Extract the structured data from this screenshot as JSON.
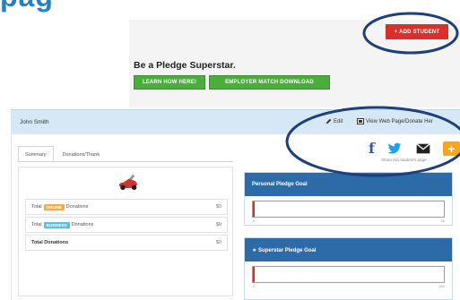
{
  "page": {
    "top_heading": "pag"
  },
  "promo": {
    "add_student_label": "+ ADD STUDENT",
    "superstar_title": "Be a Pledge Superstar.",
    "learn_button": "LEARN HOW HERE!",
    "employer_button": "EMPLOYER MATCH DOWNLOAD"
  },
  "profile": {
    "student_name": "John Smith",
    "edit_label": "Edit",
    "view_page_label": "View Web Page/Donate Her",
    "share_caption": "Share this student's page"
  },
  "tabs": [
    {
      "label": "Summary"
    },
    {
      "label": "Donations/Thank"
    }
  ],
  "donations": [
    {
      "prefix": "Total",
      "badge": "ONLINE",
      "suffix": "Donations",
      "value": "$0"
    },
    {
      "prefix": "Total",
      "badge": "BUSINESS",
      "suffix": "Donations",
      "value": "$0"
    },
    {
      "label": "Total Donations",
      "value": "$0"
    }
  ],
  "goals": {
    "personal": {
      "title": "Personal Pledge Goal",
      "min": "0",
      "max": "50",
      "progress": 0.0
    },
    "superstar": {
      "title": "★ Superstar Pledge Goal",
      "min": "0",
      "max": "250",
      "progress": 0.0
    }
  },
  "colors": {
    "accent_blue": "#2d6aa8",
    "add_red": "#d9302c",
    "cta_green": "#4aae3a",
    "header_blue": "#d6e8f5",
    "annotation_ellipse": "#1f3f7a"
  },
  "icons": [
    "edit-pencil-icon",
    "web-page-icon",
    "facebook-icon",
    "twitter-icon",
    "mail-icon",
    "plus-icon",
    "race-car-icon"
  ]
}
